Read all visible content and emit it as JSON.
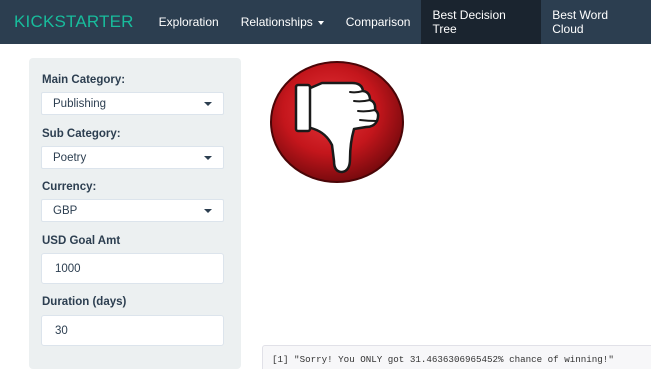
{
  "navbar": {
    "brand": "KICKSTARTER",
    "items": [
      {
        "label": "Exploration",
        "active": false
      },
      {
        "label": "Relationships",
        "active": false,
        "dropdown": true
      },
      {
        "label": "Comparison",
        "active": false
      },
      {
        "label": "Best Decision Tree",
        "active": true
      },
      {
        "label": "Best Word Cloud",
        "active": false
      }
    ]
  },
  "sidebar": {
    "main_category": {
      "label": "Main Category:",
      "value": "Publishing"
    },
    "sub_category": {
      "label": "Sub Category:",
      "value": "Poetry"
    },
    "currency": {
      "label": "Currency:",
      "value": "GBP"
    },
    "usd_goal": {
      "label": "USD Goal Amt",
      "value": "1000"
    },
    "duration": {
      "label": "Duration (days)",
      "value": "30"
    }
  },
  "result": {
    "icon": "thumbs-down-icon",
    "output_text": "[1] \"Sorry! You ONLY got 31.4636306965452% chance of winning!\""
  },
  "colors": {
    "navbar_bg": "#2c3e50",
    "brand": "#18bc9c",
    "active_tab_bg": "#1a242f",
    "sidebar_bg": "#ecf0f1",
    "thumb_red": "#c4161c"
  }
}
